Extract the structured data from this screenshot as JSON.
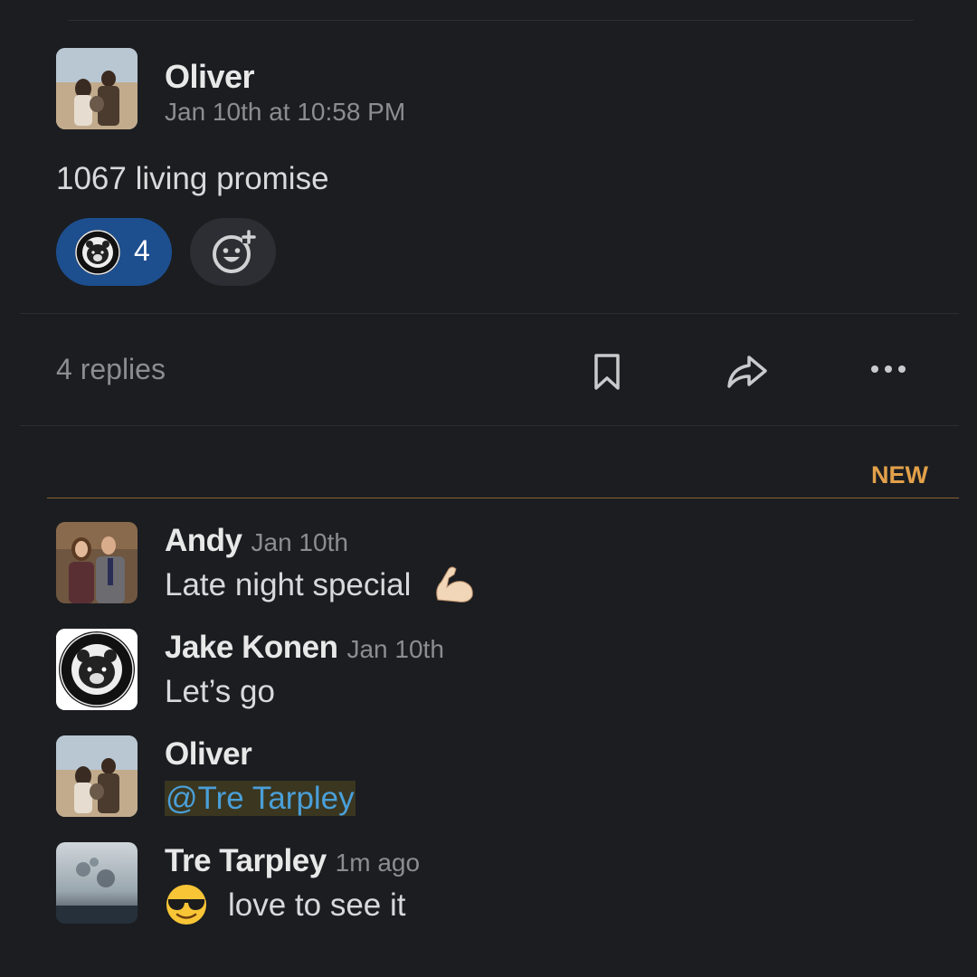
{
  "parent": {
    "author": "Oliver",
    "timestamp": "Jan 10th at 10:58 PM",
    "text": "1067 living promise",
    "reaction": {
      "emoji": "family-first-life-logo",
      "count": "4"
    }
  },
  "thread_bar": {
    "replies_label": "4 replies",
    "icons": [
      "bookmark-icon",
      "share-icon",
      "more-icon"
    ]
  },
  "new_divider": "NEW",
  "replies": [
    {
      "author": "Andy",
      "time": "Jan 10th",
      "text": "Late night special",
      "emoji": "flexed-biceps"
    },
    {
      "author": "Jake Konen",
      "time": "Jan 10th",
      "text": "Let’s go"
    },
    {
      "author": "Oliver",
      "time": "",
      "mention": "@Tre Tarpley"
    },
    {
      "author": "Tre Tarpley",
      "time": "1m ago",
      "emoji": "smiling-face-with-sunglasses",
      "text": "love to see it"
    }
  ],
  "colors": {
    "background": "#1b1d21",
    "reaction_active": "#1d4f8f",
    "new_accent": "#e2a04a",
    "mention_text": "#4a9fd8"
  }
}
